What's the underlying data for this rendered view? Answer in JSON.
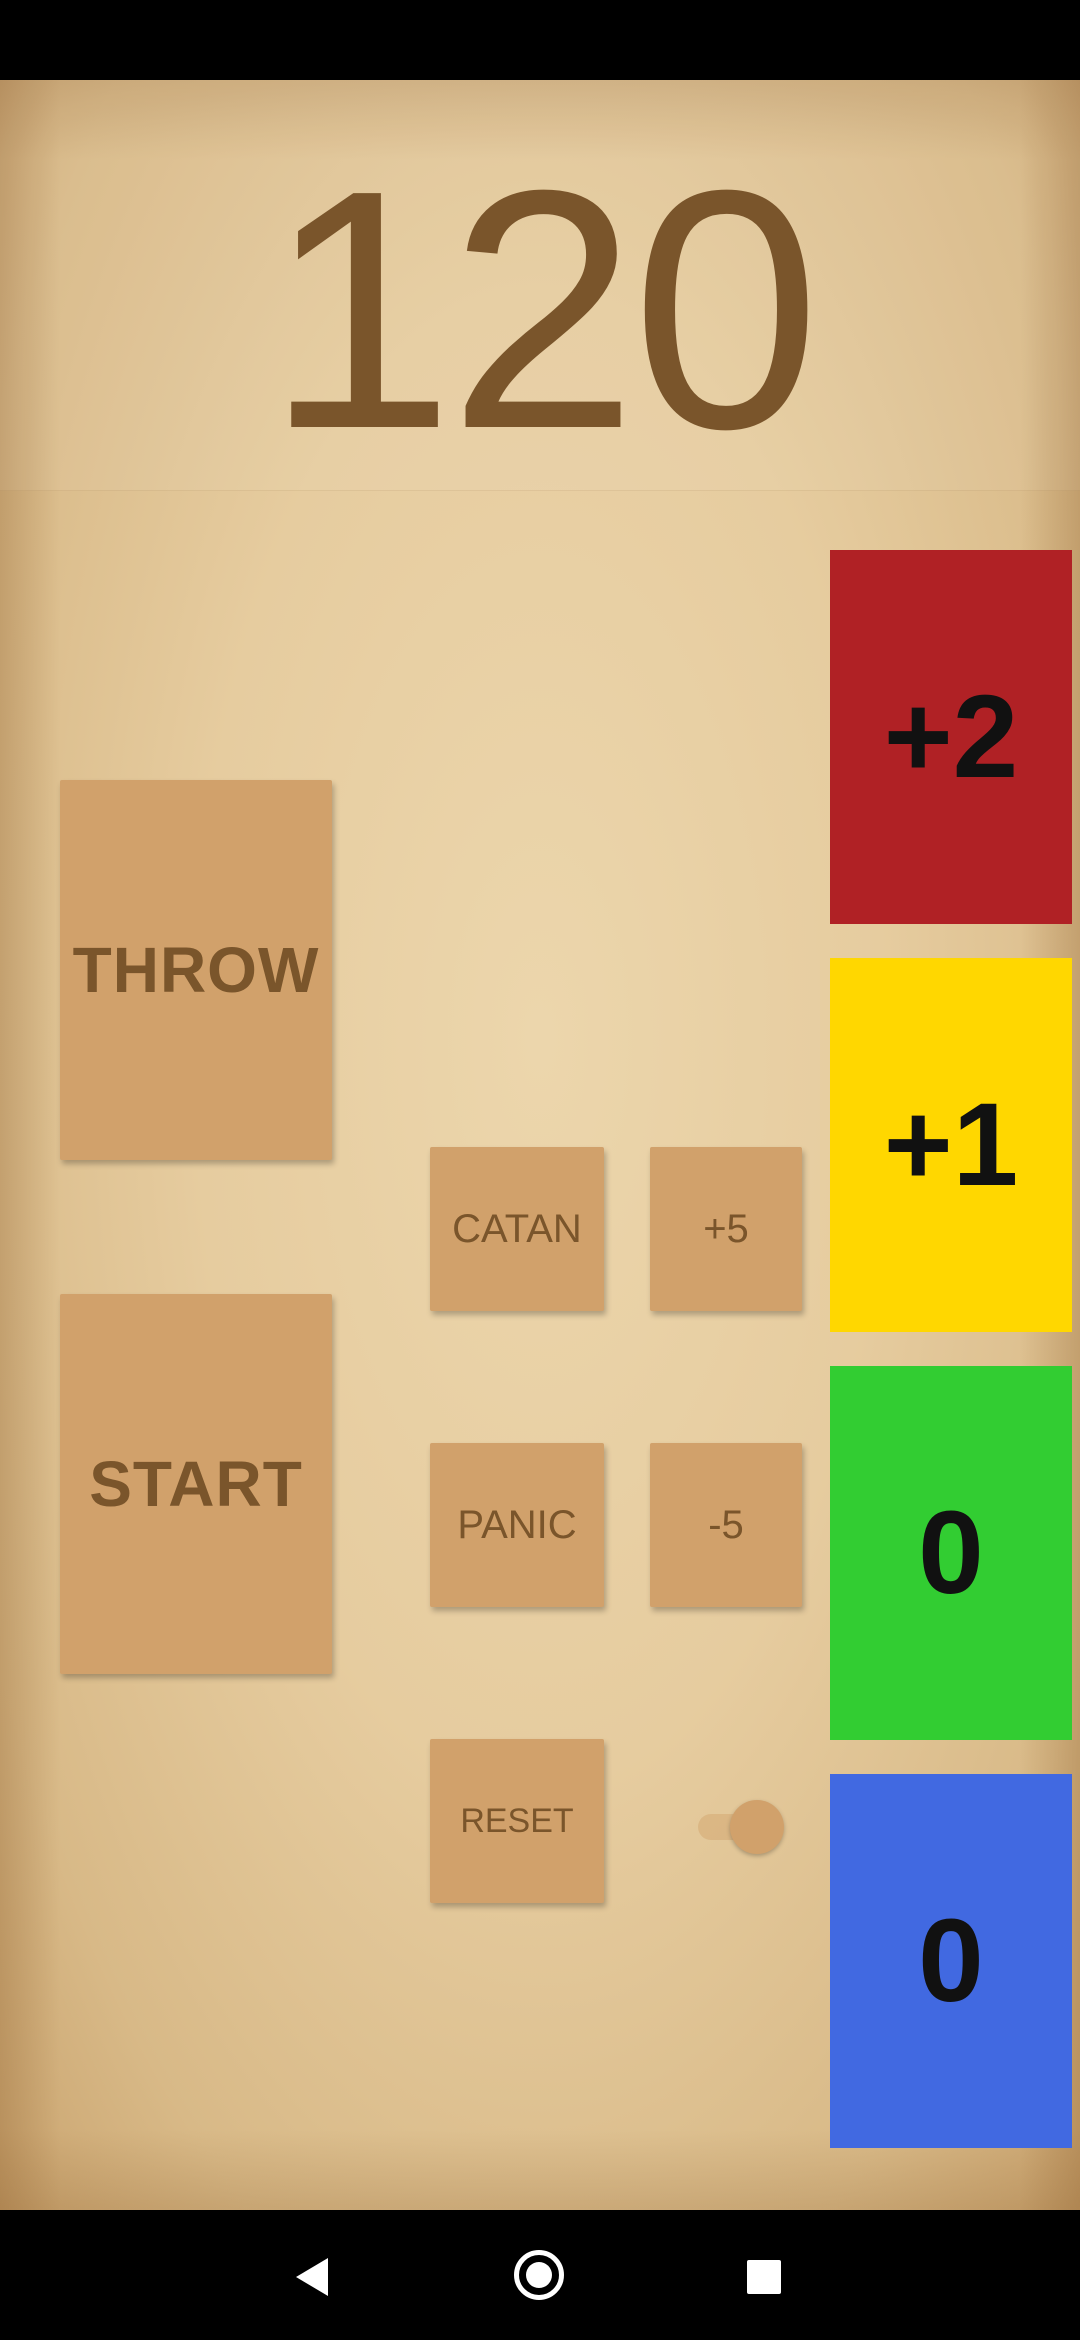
{
  "timer": {
    "value": "120"
  },
  "buttons": {
    "throw": "THROW",
    "start": "START",
    "catan": "CATAN",
    "plus5": "+5",
    "panic": "PANIC",
    "minus5": "-5",
    "reset": "RESET"
  },
  "scores": [
    {
      "value": "+2",
      "color": "#b02125"
    },
    {
      "value": "+1",
      "color": "#ffd700"
    },
    {
      "value": "0",
      "color": "#32cd32"
    },
    {
      "value": "0",
      "color": "#4169e1"
    }
  ],
  "toggle": {
    "state": "on"
  },
  "nav": {
    "back_icon": "back-triangle-icon",
    "home_icon": "home-circle-icon",
    "recents_icon": "recents-square-icon"
  }
}
